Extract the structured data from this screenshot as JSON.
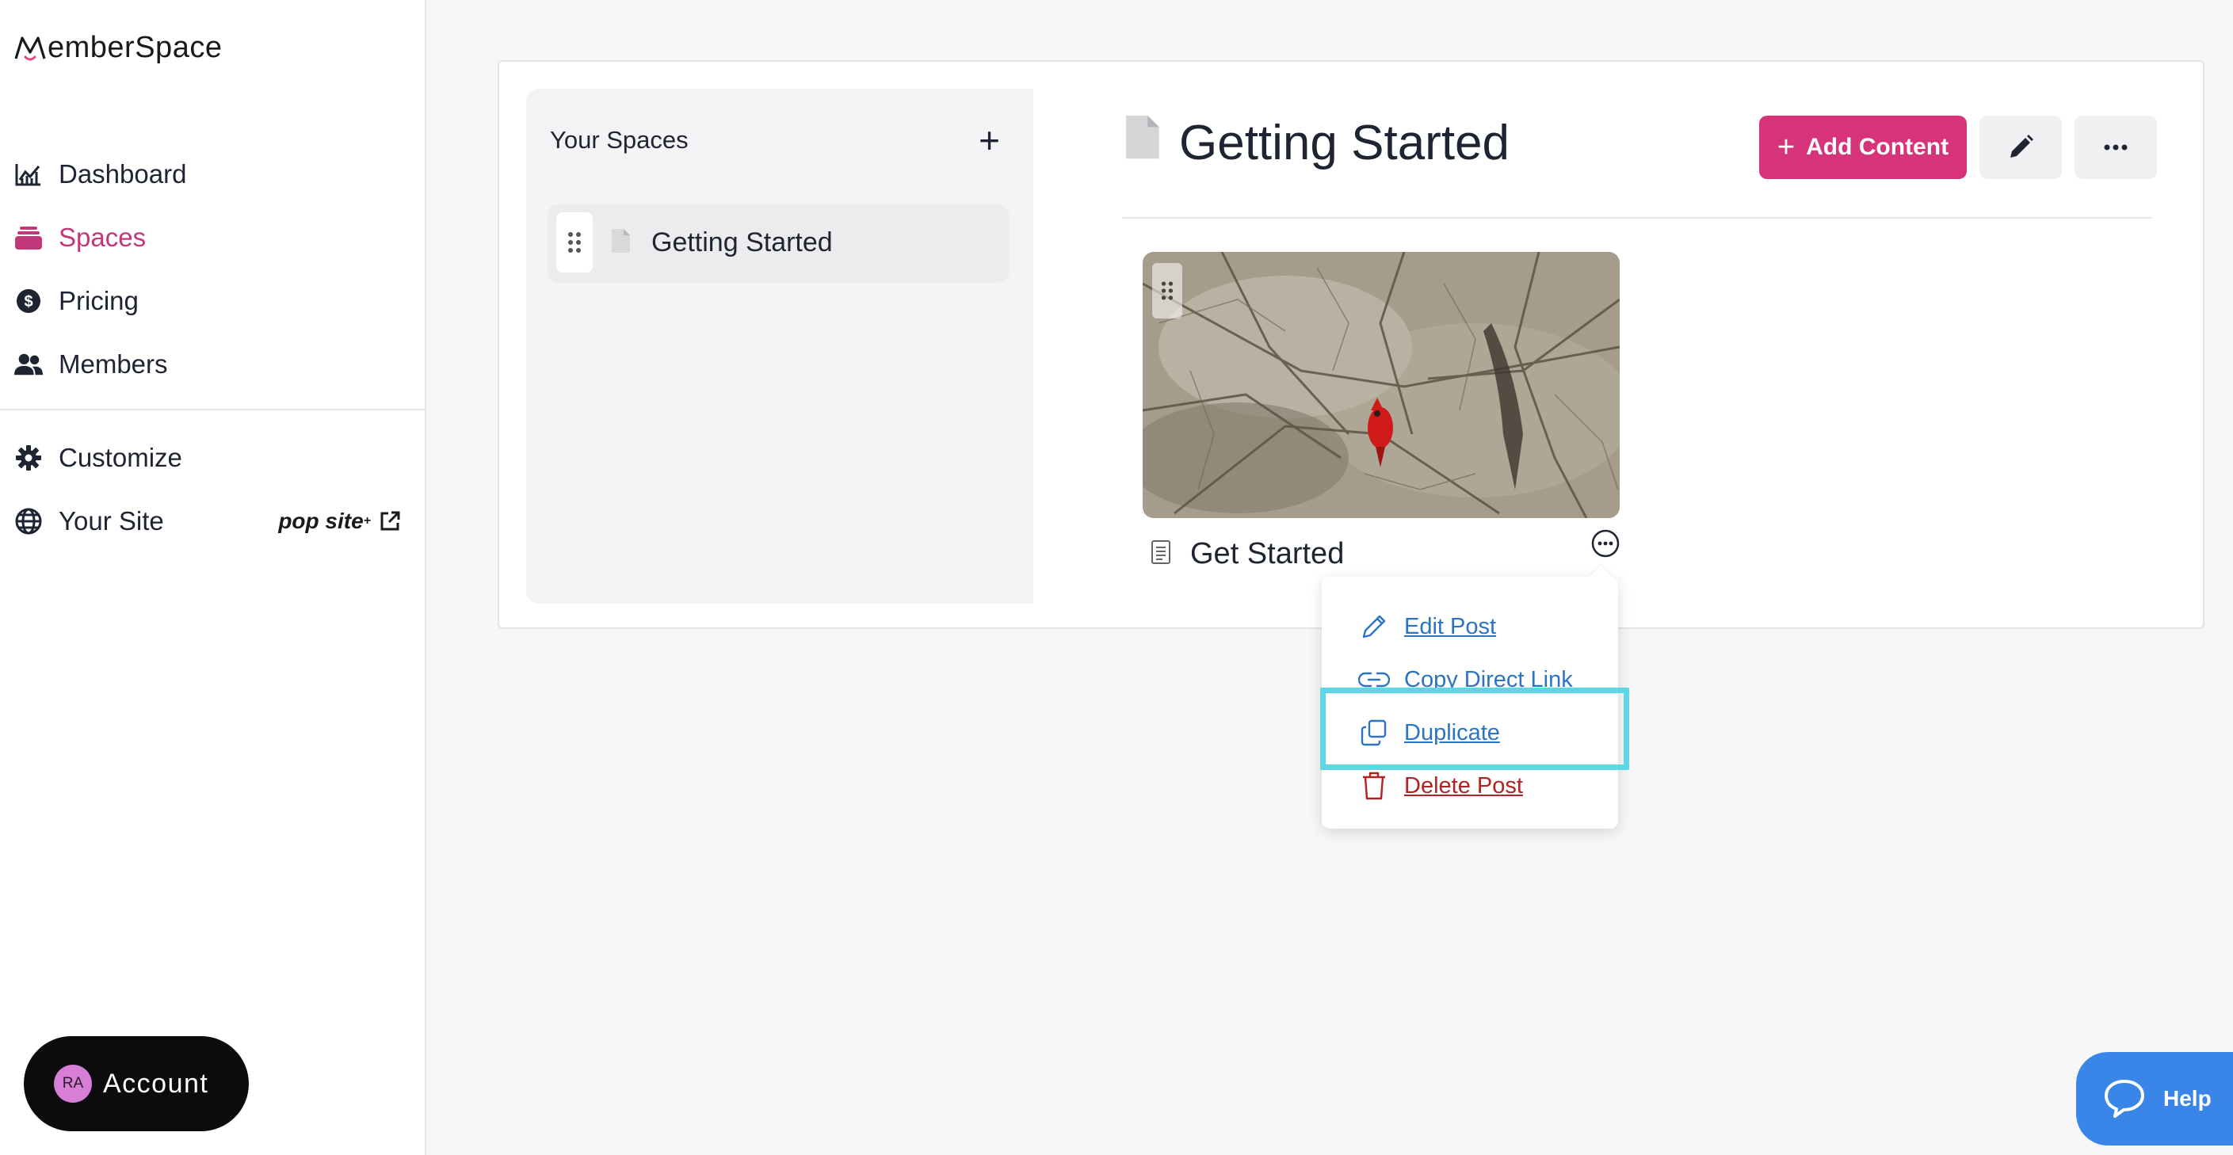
{
  "brand": {
    "name": "emberSpace",
    "logo_icon": "memberspace-m-logo"
  },
  "sidebar": {
    "nav": [
      {
        "label": "Dashboard",
        "icon": "chart-icon",
        "active": false
      },
      {
        "label": "Spaces",
        "icon": "stack-icon",
        "active": true
      },
      {
        "label": "Pricing",
        "icon": "dollar-circle-icon",
        "active": false
      },
      {
        "label": "Members",
        "icon": "users-icon",
        "active": false
      }
    ],
    "nav_secondary": [
      {
        "label": "Customize",
        "icon": "gear-icon"
      },
      {
        "label": "Your Site",
        "icon": "globe-icon",
        "badge": "pop site"
      }
    ],
    "account": {
      "initials": "RA",
      "label": "Account"
    }
  },
  "spaces_panel": {
    "title": "Your Spaces",
    "items": [
      {
        "label": "Getting Started"
      }
    ]
  },
  "page": {
    "title": "Getting Started",
    "add_content_label": "Add Content"
  },
  "post": {
    "title": "Get Started"
  },
  "dropdown": {
    "items": [
      {
        "label": "Edit Post",
        "icon": "pencil-icon",
        "color": "#2b74c4"
      },
      {
        "label": "Copy Direct Link",
        "icon": "link-icon",
        "color": "#2b74c4"
      },
      {
        "label": "Duplicate",
        "icon": "copy-icon",
        "color": "#2b74c4",
        "highlighted": true
      },
      {
        "label": "Delete Post",
        "icon": "trash-icon",
        "color": "#b22222"
      }
    ]
  },
  "help": {
    "label": "Help"
  },
  "colors": {
    "accent": "#d6337a",
    "active_nav": "#c2367a",
    "link": "#2b74c4",
    "danger": "#b22222",
    "highlight": "#5fd6e3",
    "help": "#3a86e8"
  }
}
